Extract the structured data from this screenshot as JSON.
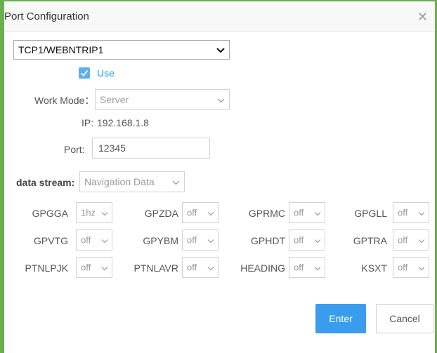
{
  "dialog": {
    "title": "Port Configuration",
    "close_icon": "close-icon"
  },
  "port_select": {
    "value": "TCP1/WEBNTRIP1"
  },
  "use": {
    "label": "Use",
    "checked": true
  },
  "work_mode": {
    "label": "Work Mode：",
    "value": "Server"
  },
  "ip": {
    "label": "IP:",
    "value": "192.168.1.8"
  },
  "port": {
    "label": "Port:",
    "value": "12345"
  },
  "data_stream": {
    "label": "data stream:",
    "value": "Navigation Data"
  },
  "messages": [
    {
      "name": "GPGGA",
      "value": "1hz"
    },
    {
      "name": "GPZDA",
      "value": "off"
    },
    {
      "name": "GPRMC",
      "value": "off"
    },
    {
      "name": "GPGLL",
      "value": "off"
    },
    {
      "name": "GPVTG",
      "value": "off"
    },
    {
      "name": "GPYBM",
      "value": "off"
    },
    {
      "name": "GPHDT",
      "value": "off"
    },
    {
      "name": "GPTRA",
      "value": "off"
    },
    {
      "name": "PTNLPJK",
      "value": "off"
    },
    {
      "name": "PTNLAVR",
      "value": "off"
    },
    {
      "name": "HEADING",
      "value": "off"
    },
    {
      "name": "KSXT",
      "value": "off"
    }
  ],
  "buttons": {
    "enter": "Enter",
    "cancel": "Cancel"
  },
  "colors": {
    "accent": "#3a9cec",
    "frame": "#6ab04c"
  }
}
